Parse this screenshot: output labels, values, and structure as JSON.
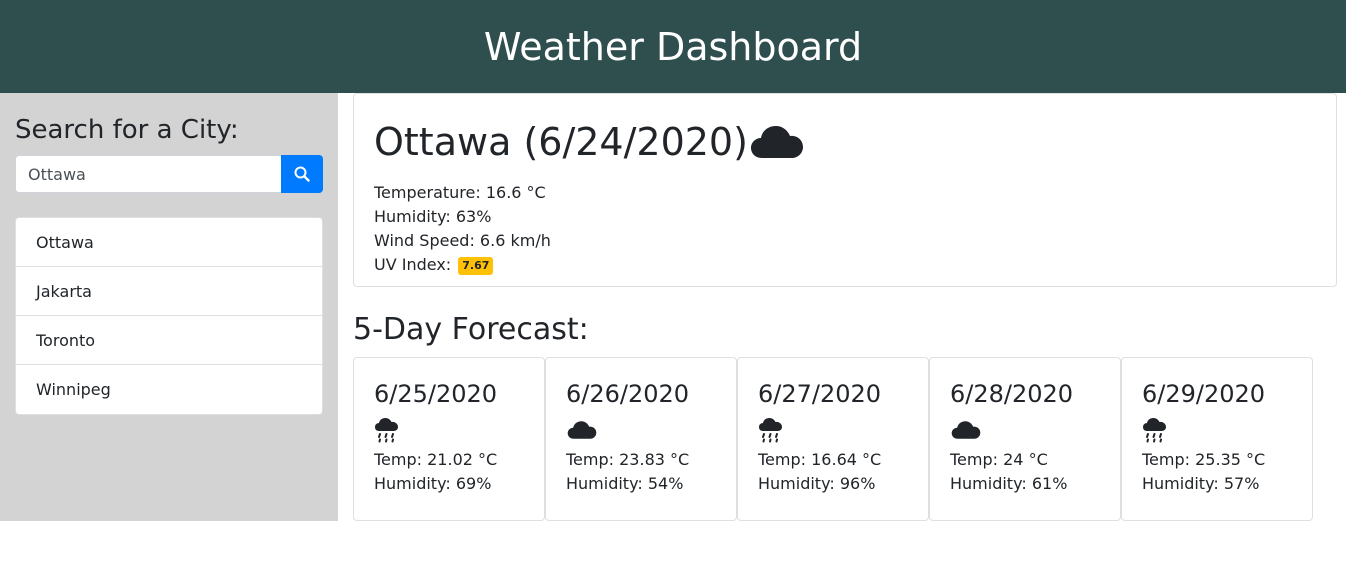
{
  "header": {
    "title": "Weather Dashboard"
  },
  "sidebar": {
    "title": "Search for a City:",
    "search_value": "Ottawa",
    "search_icon": "search-icon",
    "cities": [
      "Ottawa",
      "Jakarta",
      "Toronto",
      "Winnipeg"
    ]
  },
  "current": {
    "title": "Ottawa (6/24/2020)",
    "icon": "cloud-icon",
    "temperature": "Temperature: 16.6 °C",
    "humidity": "Humidity: 63%",
    "wind": "Wind Speed: 6.6 km/h",
    "uv_label": "UV Index: ",
    "uv_value": "7.67"
  },
  "forecast": {
    "title": "5-Day Forecast:",
    "days": [
      {
        "date": "6/25/2020",
        "icon": "rain-icon",
        "temp": "Temp: 21.02 °C",
        "humidity": "Humidity: 69%"
      },
      {
        "date": "6/26/2020",
        "icon": "cloud-icon",
        "temp": "Temp: 23.83 °C",
        "humidity": "Humidity: 54%"
      },
      {
        "date": "6/27/2020",
        "icon": "rain-icon",
        "temp": "Temp: 16.64 °C",
        "humidity": "Humidity: 96%"
      },
      {
        "date": "6/28/2020",
        "icon": "cloud-icon",
        "temp": "Temp: 24 °C",
        "humidity": "Humidity: 61%"
      },
      {
        "date": "6/29/2020",
        "icon": "rain-icon",
        "temp": "Temp: 25.35 °C",
        "humidity": "Humidity: 57%"
      }
    ]
  },
  "colors": {
    "header_bg": "#2f4f4f",
    "sidebar_bg": "#d3d3d3",
    "search_button": "#007bff",
    "uv_badge": "#ffc107"
  }
}
